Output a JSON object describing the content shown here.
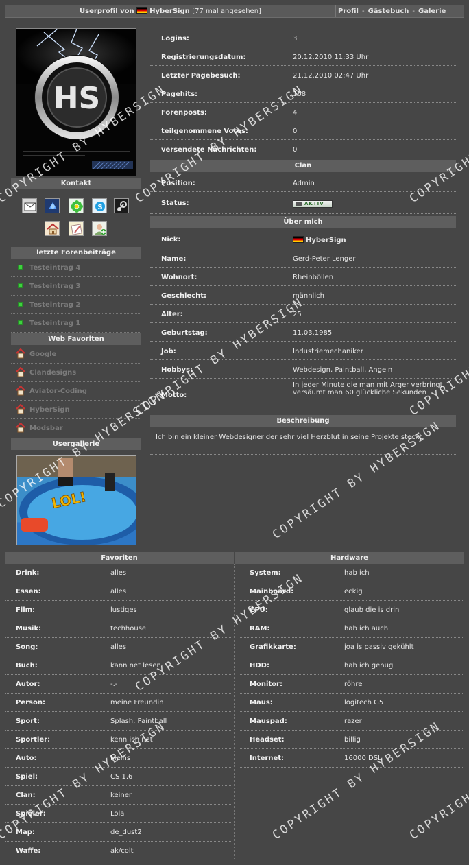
{
  "header": {
    "title_prefix": "Userprofil von",
    "username": "HyberSign",
    "views": "[77 mal angesehen]",
    "nav": [
      "Profil",
      "Gästebuch",
      "Galerie"
    ]
  },
  "left": {
    "kontakt_title": "Kontakt",
    "contact_icons": [
      "mail-icon",
      "msn-icon",
      "icq-icon",
      "skype-icon",
      "steam-icon",
      "homepage-icon",
      "notes-icon",
      "add-buddy-icon"
    ],
    "forum_title": "letzte Forenbeiträge",
    "forum_posts": [
      "Testeintrag 4",
      "Testeintrag 3",
      "Testeintrag 2",
      "Testeintrag 1"
    ],
    "favorites_title": "Web Favoriten",
    "favorites": [
      "Google",
      "Clandesigns",
      "Aviator-Coding",
      "HyberSign",
      "Modsbar"
    ],
    "gallery_title": "Usergallerie",
    "gallery_overlay": "LOL!"
  },
  "stats": [
    {
      "label": "Logins:",
      "value": "3"
    },
    {
      "label": "Registrierungsdatum:",
      "value": "20.12.2010 11:33 Uhr"
    },
    {
      "label": "Letzter Pagebesuch:",
      "value": "21.12.2010 02:47 Uhr"
    },
    {
      "label": "Pagehits:",
      "value": "168"
    },
    {
      "label": "Forenposts:",
      "value": "4"
    },
    {
      "label": "teilgenommene Votes:",
      "value": "0"
    },
    {
      "label": "versendete Nachrichten:",
      "value": "0"
    }
  ],
  "clan": {
    "title": "Clan",
    "position_label": "Position:",
    "position_value": "Admin",
    "status_label": "Status:",
    "status_badge": "AKTIV"
  },
  "about": {
    "title": "Über mich",
    "rows": [
      {
        "label": "Nick:",
        "value": "HyberSign"
      },
      {
        "label": "Name:",
        "value": "Gerd-Peter Lenger"
      },
      {
        "label": "Wohnort:",
        "value": "Rheinböllen"
      },
      {
        "label": "Geschlecht:",
        "value": "männlich"
      },
      {
        "label": "Alter:",
        "value": "25"
      },
      {
        "label": "Geburtstag:",
        "value": "11.03.1985"
      },
      {
        "label": "Job:",
        "value": "Industriemechaniker"
      },
      {
        "label": "Hobbys:",
        "value": "Webdesign, Paintball, Angeln"
      }
    ],
    "motto_label": "Motto:",
    "motto_value": "In jeder Minute die man mit Ärger verbringt versäumt man 60 glückliche Sekunden"
  },
  "description": {
    "title": "Beschreibung",
    "text": "Ich bin ein kleiner Webdesigner der sehr viel Herzblut in seine Projekte steckt."
  },
  "favoriten": {
    "title": "Favoriten",
    "rows": [
      {
        "label": "Drink:",
        "value": "alles"
      },
      {
        "label": "Essen:",
        "value": "alles"
      },
      {
        "label": "Film:",
        "value": "lustiges"
      },
      {
        "label": "Musik:",
        "value": "techhouse"
      },
      {
        "label": "Song:",
        "value": "alles"
      },
      {
        "label": "Buch:",
        "value": "kann net lesen"
      },
      {
        "label": "Autor:",
        "value": "-.-"
      },
      {
        "label": "Person:",
        "value": "meine Freundin"
      },
      {
        "label": "Sport:",
        "value": "Splash, Paintball"
      },
      {
        "label": "Sportler:",
        "value": "kenn ich net"
      },
      {
        "label": "Auto:",
        "value": "Meins"
      },
      {
        "label": "Spiel:",
        "value": "CS 1.6"
      },
      {
        "label": "Clan:",
        "value": "keiner"
      },
      {
        "label": "Spieler:",
        "value": "Lola"
      },
      {
        "label": "Map:",
        "value": "de_dust2"
      },
      {
        "label": "Waffe:",
        "value": "ak/colt"
      }
    ]
  },
  "hardware": {
    "title": "Hardware",
    "rows": [
      {
        "label": "System:",
        "value": "hab ich"
      },
      {
        "label": "Mainboard:",
        "value": "eckig"
      },
      {
        "label": "CPU:",
        "value": "glaub die is drin"
      },
      {
        "label": "RAM:",
        "value": "hab ich auch"
      },
      {
        "label": "Grafikkarte:",
        "value": "joa is passiv gekühlt"
      },
      {
        "label": "HDD:",
        "value": "hab ich genug"
      },
      {
        "label": "Monitor:",
        "value": "röhre"
      },
      {
        "label": "Maus:",
        "value": "logitech G5"
      },
      {
        "label": "Mauspad:",
        "value": "razer"
      },
      {
        "label": "Headset:",
        "value": "billig"
      },
      {
        "label": "Internet:",
        "value": "16000 DSL"
      }
    ]
  },
  "watermark": "COPYRIGHT BY HYBERSIGN"
}
